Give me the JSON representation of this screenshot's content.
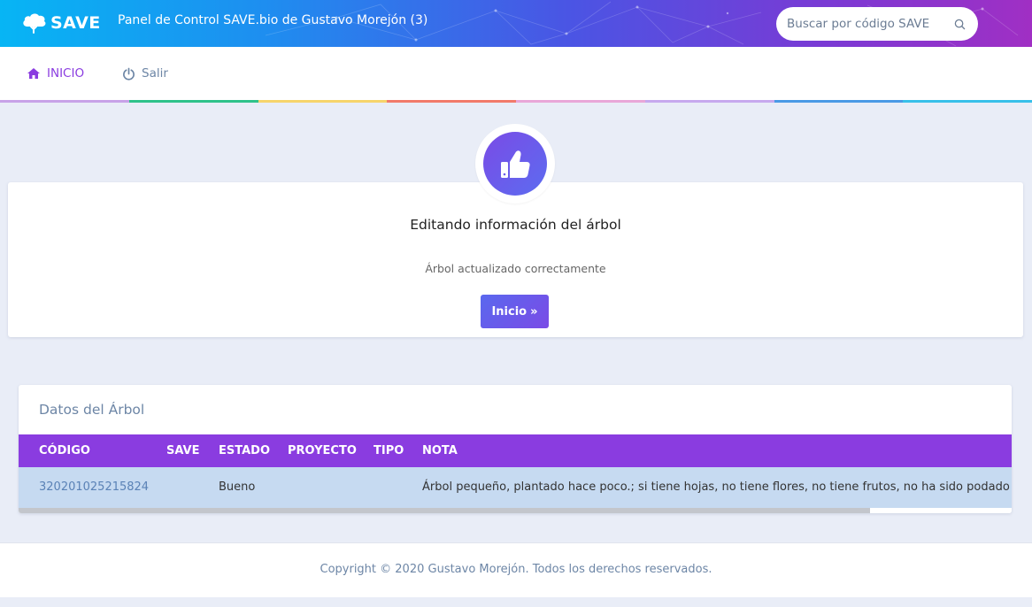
{
  "header": {
    "brand": "SAVE",
    "panel_title": "Panel de Control SAVE.bio de Gustavo Morejón (3)",
    "search_placeholder": "Buscar por código SAVE",
    "gradient_start": "#07b5f4",
    "gradient_end": "#a02fc4"
  },
  "nav": {
    "home_label": "INICIO",
    "exit_label": "Salir",
    "stripe_colors": [
      "#c8a2e8",
      "#2fc28a",
      "#f6d46b",
      "#f27a6a",
      "#e9a7d8",
      "#c7a9ee",
      "#4a9ae6",
      "#38c0ea"
    ]
  },
  "success": {
    "icon": "thumbs-up-icon",
    "title": "Editando información del árbol",
    "message": "Árbol actualizado correctamente",
    "button_label": "Inicio"
  },
  "tree_data": {
    "title": "Datos del Árbol",
    "columns": [
      "CÓDIGO",
      "SAVE",
      "ESTADO",
      "PROYECTO",
      "TIPO",
      "NOTA"
    ],
    "rows": [
      {
        "codigo": "320201025215824",
        "save": "",
        "estado": "Bueno",
        "proyecto": "",
        "tipo": "",
        "nota": "Árbol pequeño, plantado hace poco.; si tiene hojas, no tiene flores, no tiene frutos, no ha sido podado"
      }
    ]
  },
  "footer": {
    "copyright": "Copyright © 2020 Gustavo Morejón. Todos los derechos reservados."
  }
}
